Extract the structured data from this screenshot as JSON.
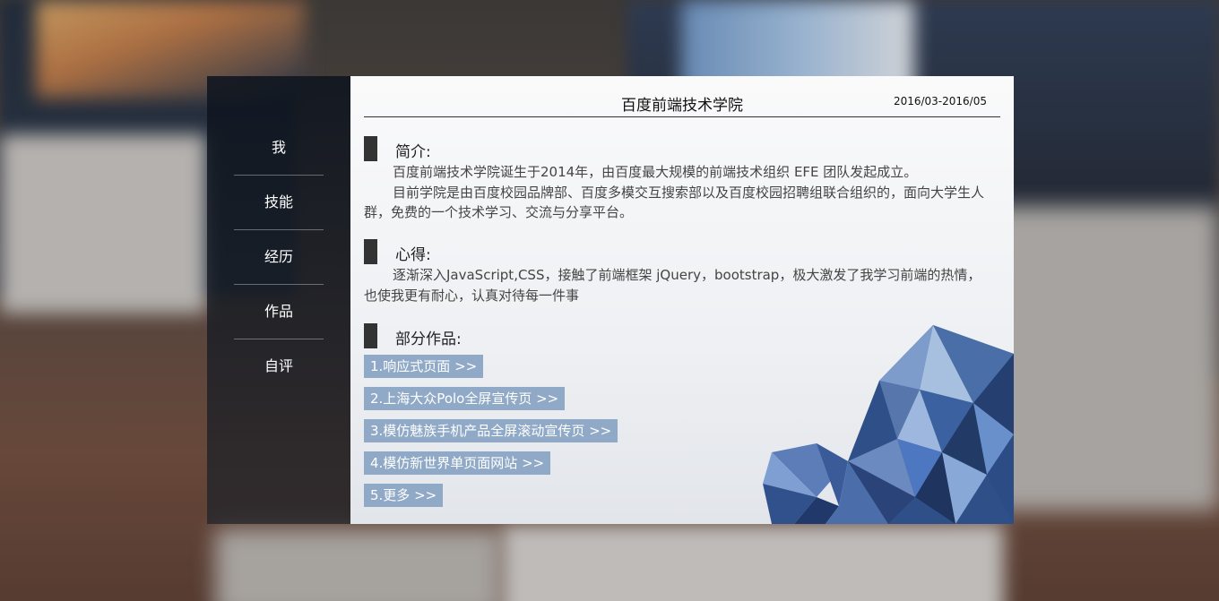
{
  "nav": {
    "items": [
      "我",
      "技能",
      "经历",
      "作品",
      "自评"
    ]
  },
  "header": {
    "title": "百度前端技术学院",
    "date": "2016/03-2016/05"
  },
  "intro": {
    "heading": "简介:",
    "lines": [
      "百度前端技术学院诞生于2014年，由百度最大规模的前端技术组织 EFE 团队发起成立。",
      "目前学院是由百度校园品牌部、百度多模交互搜索部以及百度校园招聘组联合组织的，面向大学生人群，免费的一个技术学习、交流与分享平台。"
    ]
  },
  "experience": {
    "heading": "心得:",
    "text": "逐渐深入JavaScript,CSS，接触了前端框架 jQuery，bootstrap，极大激发了我学习前端的热情，也使我更有耐心，认真对待每一件事"
  },
  "works": {
    "heading": "部分作品:",
    "items": [
      "1.响应式页面  >>",
      "2.上海大众Polo全屏宣传页  >>",
      "3.模仿魅族手机产品全屏滚动宣传页  >>",
      "4.模仿新世界单页面网站  >>",
      "5.更多  >>"
    ]
  },
  "colors": {
    "sidebar": "#0e141e",
    "heading_bar": "#333333",
    "work_button": "#8fa9c6",
    "gem": "#3f6bb0"
  },
  "icons": {
    "decoration": "polygon-gem-image"
  }
}
